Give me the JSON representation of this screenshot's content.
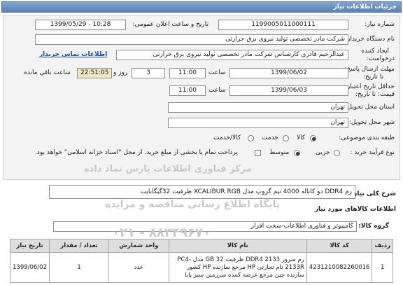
{
  "header": {
    "title": "جزئیات اطلاعات نیاز"
  },
  "form": {
    "need_number": {
      "label": "شماره نیاز:",
      "value": "1199005011000111"
    },
    "announce_datetime": {
      "label": "تاریخ و ساعت اعلان عمومی:",
      "value": "1399/05/29 - 10:28"
    },
    "buyer_org": {
      "label": "نام دستگاه خریدار:",
      "value": "شرکت مادر تخصصی تولید نیروی برق حرارتی"
    },
    "creator": {
      "label_line1": "ایجاد کننده",
      "label_line2": "درخواست:",
      "value": "عبدالرحیم قادری کارشناس شرکت مادر تخصصی تولید نیروی برق حرارتی",
      "contact_link": "اطلاعات تماس خریدار"
    },
    "reply_deadline": {
      "label_line1": "مهلت ارسال پاسخ:",
      "label_line2": "تا تاریخ:",
      "date": "1399/06/02",
      "time_label": "ساعت",
      "time": "11:00",
      "days": "3",
      "days_label": "روز و",
      "remaining": "22:51:05",
      "remaining_label": "ساعت باقی مانده"
    },
    "validity_deadline": {
      "label_line1": "حداقل تاریخ اعتبار",
      "label_line2": "قیمت: تا تاریخ:",
      "date": "1399/06/03",
      "time_label": "ساعت",
      "time": "11:00"
    },
    "province": {
      "label": "استان محل تحویل:",
      "value": "تهران"
    },
    "city": {
      "label": "شهر محل تحویل:",
      "value": "تهران"
    },
    "category": {
      "label": "طبقه بندی موضوعی:",
      "opt1": "کالا",
      "opt2": "خدمت",
      "opt3": "کالا/خدمت"
    },
    "process_type": {
      "label": "نوع فرآیند خرید :",
      "opt1": "جزیی",
      "opt2": "متوسط",
      "payment_note": "پرداخت تمام یا بخشی از مبلغ خرید، از محل \"اسناد خزانه اسلامی\" خواهد بود."
    }
  },
  "summary": {
    "label": "شرح کلی نیاز:",
    "value": "رم DDR4 دو کاناله 4000 تیم گروپ مدل XCALIBUR RGB ظرفیت 32گیگابایت"
  },
  "goods_section": {
    "title": "اطلاعات کالاهای مورد نیاز"
  },
  "goods_group": {
    "label": "گروه کالا:",
    "value": "کامپیوتر و فناوری اطلاعات-سخت افزار"
  },
  "table": {
    "headers": [
      "ردیف",
      "کد کالا",
      "نام کالا",
      "واحد شمارش",
      "تعداد / مقدار",
      "تاریخ نیاز"
    ],
    "rows": [
      {
        "row": "1",
        "code": "4231210082260016",
        "name": "رم سرور DDR4 2133 ظرفیت 32 GB مدل PC4-2133R نام تجارتی HP مرجع سازنده HP کشور سازنده چین مرجع عرضه کننده سرزمین سبز پایا",
        "unit": "عدد",
        "qty": "1",
        "date": "1399/06/02"
      }
    ]
  },
  "watermark": {
    "line1": "مرکز فناوری اطلاعات پارس نماد داده",
    "line2": "پایگاه اطلاع رسانی مناقصه و مزایده",
    "line3": "۰۲۱ - ۸۸۳۴۹۶۷۰"
  },
  "colors": {
    "header_bg": "#6b91c2",
    "link": "#1b4fa8",
    "panel_bg": "#f3f3f3",
    "remaining_bg": "#f0e6c0"
  }
}
